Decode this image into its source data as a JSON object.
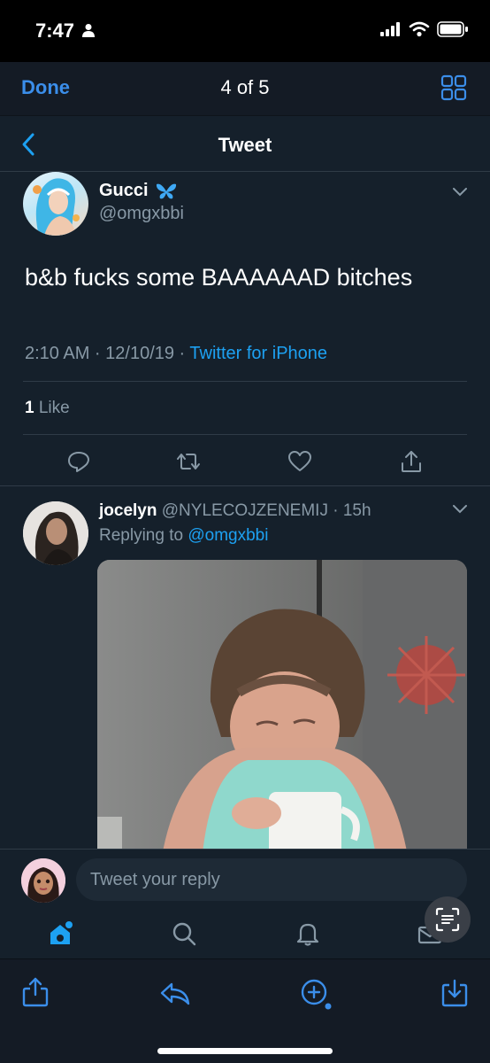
{
  "status_bar": {
    "time": "7:47"
  },
  "viewer": {
    "done_label": "Done",
    "page_counter": "4 of 5"
  },
  "nav": {
    "title": "Tweet"
  },
  "tweet": {
    "display_name": "Gucci",
    "handle": "@omgxbbi",
    "text": "b&b fucks some BAAAAAAD bitches",
    "timestamp": "2:10 AM · 12/10/19 · ",
    "source": "Twitter for iPhone",
    "like_count": "1",
    "like_label": " Like"
  },
  "reply": {
    "display_name": "jocelyn",
    "meta": " @NYLECOJZENEMIJ · 15h",
    "replying_prefix": "Replying to ",
    "replying_to": "@omgxbbi"
  },
  "composer": {
    "placeholder": "Tweet your reply"
  },
  "colors": {
    "accent": "#1da1f2",
    "ios_blue": "#3b8eea",
    "background": "#15202b",
    "muted": "#8899a6"
  }
}
